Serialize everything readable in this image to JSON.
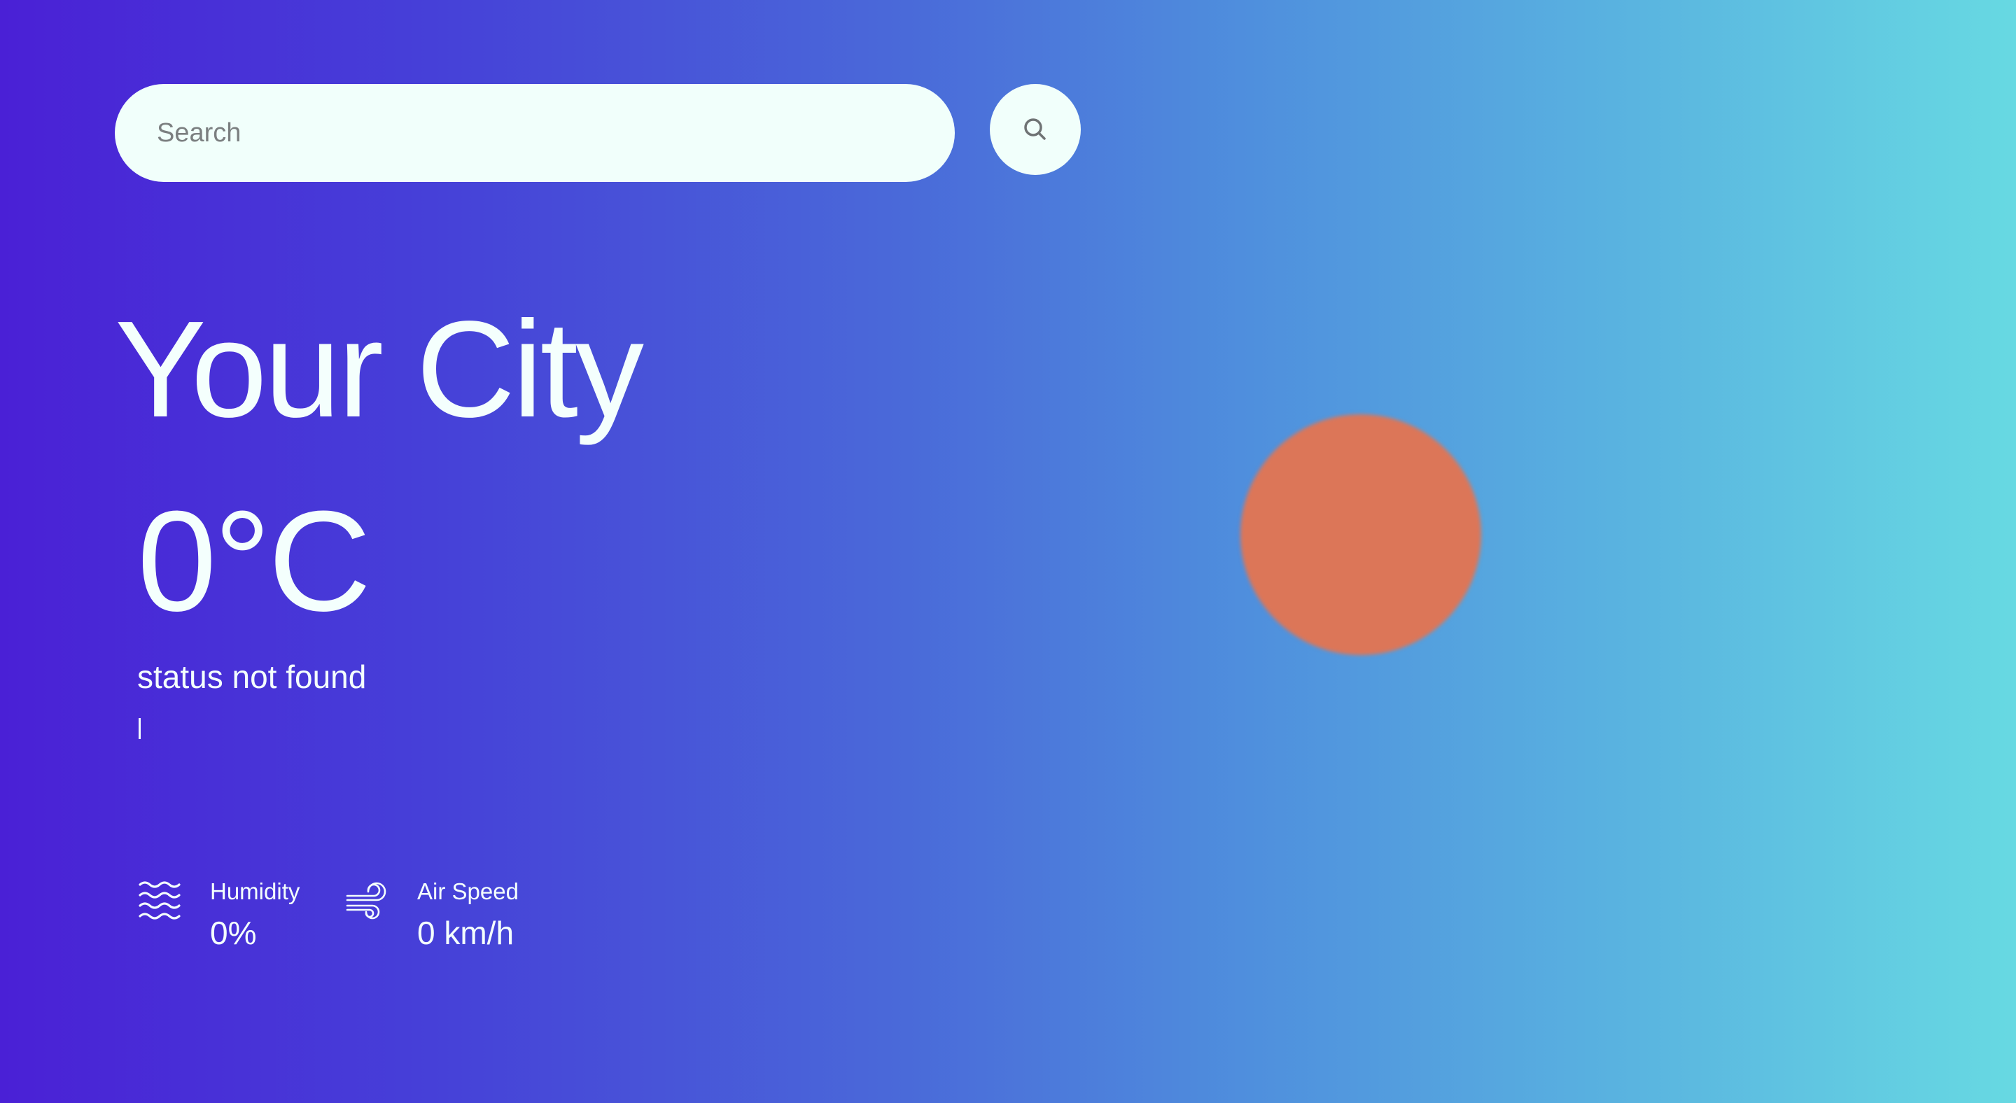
{
  "search": {
    "placeholder": "Search",
    "value": "",
    "button_icon": "search-icon"
  },
  "weather": {
    "city": "Your City",
    "temperature": "0°C",
    "status": "status not found"
  },
  "stats": {
    "humidity": {
      "icon": "waves-icon",
      "label": "Humidity",
      "value": "0%"
    },
    "wind": {
      "icon": "wind-icon",
      "label": "Air Speed",
      "value": "0 km/h"
    }
  },
  "visual": {
    "sun_icon": "sun-icon",
    "sun_color": "#dc7658",
    "gradient_start": "#4a20d6",
    "gradient_end": "#67d9e2"
  }
}
